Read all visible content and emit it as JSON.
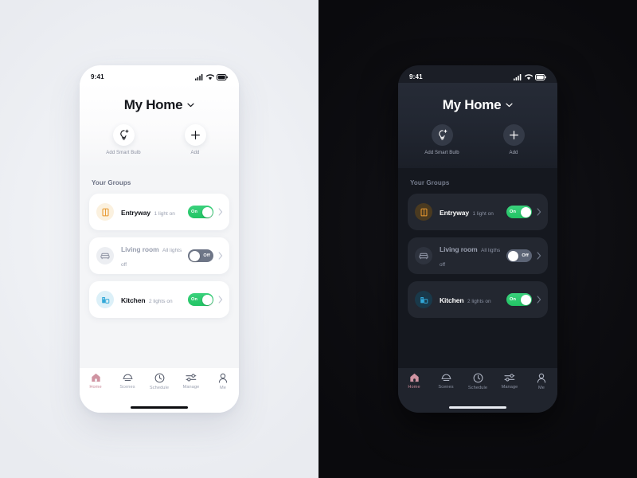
{
  "theme_colors": {
    "light_bg": "#eff1f5",
    "dark_bg": "#0d0d11",
    "accent_green": "#22c464",
    "toggle_off_gray": "#6e7687",
    "active_tab_pink": "#c98a9a",
    "entryway_icon": "#e8982f",
    "entryway_icon_bg": "#fbf1df",
    "livingroom_icon": "#8b90a0",
    "livingroom_icon_bg": "#eceef2",
    "kitchen_icon": "#31a8d8",
    "kitchen_icon_bg": "#dcf0f8"
  },
  "status_bar": {
    "time": "9:41",
    "icons": [
      "signal-icon",
      "wifi-icon",
      "battery-icon"
    ]
  },
  "header": {
    "title": "My Home",
    "dropdown_icon": "chevron-down-icon",
    "quick_actions": [
      {
        "label": "Add Smart Bulb",
        "icon": "smart-bulb-icon"
      },
      {
        "label": "Add",
        "icon": "plus-icon"
      }
    ]
  },
  "groups_section": {
    "title": "Your Groups",
    "light": [
      {
        "name": "Entryway",
        "status": "1 light on",
        "icon": "door-icon",
        "toggle": "On",
        "toggle_state": "on",
        "chevron": "chevron-right-icon"
      },
      {
        "name": "Living room",
        "status": "All lights off",
        "icon": "sofa-icon",
        "toggle": "Off",
        "toggle_state": "off",
        "chevron": "chevron-right-icon"
      },
      {
        "name": "Kitchen",
        "status": "2 lights on",
        "icon": "fridge-icon",
        "toggle": "On",
        "toggle_state": "on",
        "chevron": "chevron-right-icon"
      }
    ],
    "dark": [
      {
        "name": "Entryway",
        "status": "1 light on",
        "icon": "door-icon",
        "toggle": "On",
        "toggle_state": "on",
        "chevron": "chevron-right-icon"
      },
      {
        "name": "Living room",
        "status": "All ligths off",
        "icon": "sofa-icon",
        "toggle": "Off",
        "toggle_state": "off",
        "chevron": "chevron-right-icon"
      },
      {
        "name": "Kitchen",
        "status": "2 lights on",
        "icon": "fridge-icon",
        "toggle": "On",
        "toggle_state": "on",
        "chevron": "chevron-right-icon"
      }
    ]
  },
  "tabbar": {
    "items": [
      {
        "label": "Home",
        "icon": "home-icon",
        "active": true
      },
      {
        "label": "Scenes",
        "icon": "scenes-icon",
        "active": false
      },
      {
        "label": "Schedule",
        "icon": "clock-icon",
        "active": false
      },
      {
        "label": "Manage",
        "icon": "sliders-icon",
        "active": false
      },
      {
        "label": "Me",
        "icon": "person-icon",
        "active": false
      }
    ]
  }
}
